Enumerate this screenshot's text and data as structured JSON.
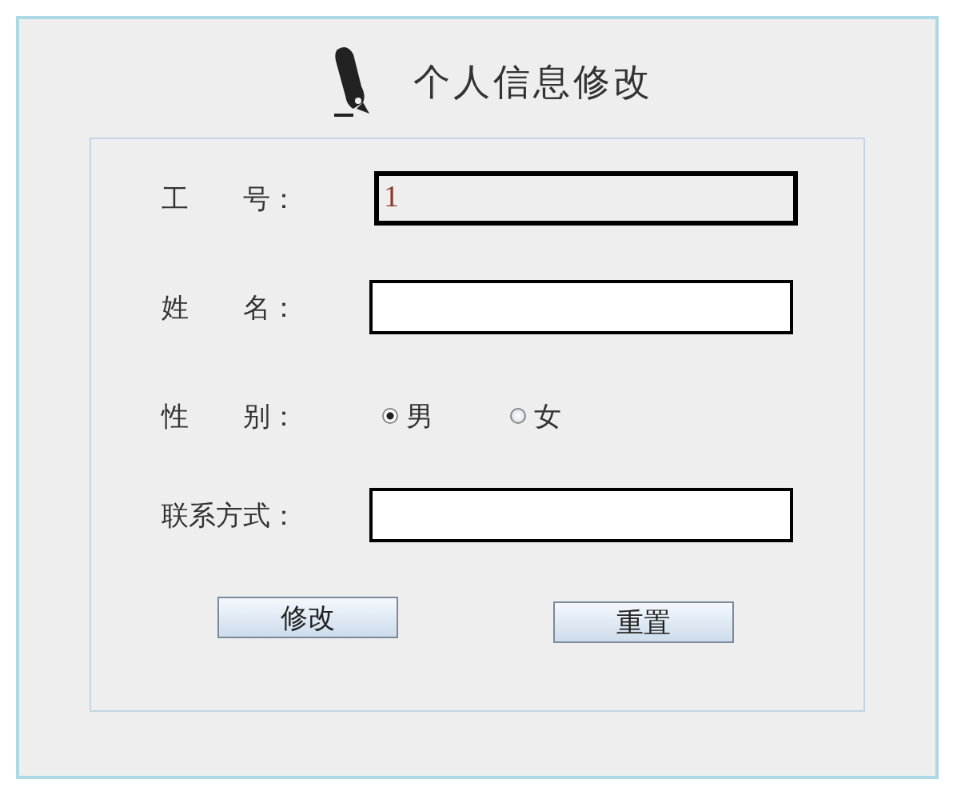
{
  "title": "个人信息修改",
  "fields": [
    {
      "label": "工　　号：",
      "value": "1",
      "disabled": true
    },
    {
      "label": "姓　　名：",
      "disabled": false
    },
    {
      "label": "性　　别：",
      "kind": "radio",
      "options": [
        {
          "label": "男",
          "selected": true
        },
        {
          "label": "女",
          "selected": false
        }
      ]
    },
    {
      "label": "联系方式：",
      "disabled": false
    }
  ],
  "buttons": [
    "修改",
    "重置"
  ]
}
